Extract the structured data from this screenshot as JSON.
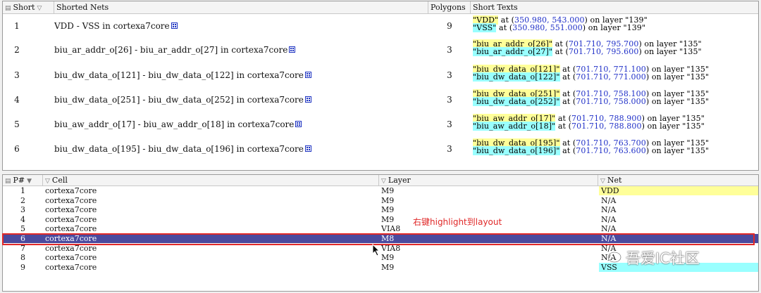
{
  "top_table": {
    "headers": {
      "short": "Short",
      "nets": "Shorted Nets",
      "polygons": "Polygons",
      "texts": "Short Texts"
    },
    "rows": [
      {
        "index": "1",
        "nets": "VDD - VSS in cortexa7core",
        "polygons": "9",
        "t1_name": "\"VDD\"",
        "t1_mid": " at (",
        "t1_coord": "350.980, 543.000",
        "t1_end": ") on layer \"139\"",
        "t2_name": "\"VSS\"",
        "t2_mid": " at (",
        "t2_coord": "350.980, 551.000",
        "t2_end": ") on layer \"139\""
      },
      {
        "index": "2",
        "nets": "biu_ar_addr_o[26] - biu_ar_addr_o[27] in cortexa7core",
        "polygons": "3",
        "t1_name": "\"biu_ar_addr_o[26]\"",
        "t1_mid": " at (",
        "t1_coord": "701.710, 795.700",
        "t1_end": ") on layer \"135\"",
        "t2_name": "\"biu_ar_addr_o[27]\"",
        "t2_mid": " at (",
        "t2_coord": "701.710, 795.600",
        "t2_end": ") on layer \"135\""
      },
      {
        "index": "3",
        "nets": "biu_dw_data_o[121] - biu_dw_data_o[122] in cortexa7core",
        "polygons": "3",
        "t1_name": "\"biu_dw_data_o[121]\"",
        "t1_mid": " at (",
        "t1_coord": "701.710, 771.100",
        "t1_end": ") on layer \"135\"",
        "t2_name": "\"biu_dw_data_o[122]\"",
        "t2_mid": " at (",
        "t2_coord": "701.710, 771.000",
        "t2_end": ") on layer \"135\""
      },
      {
        "index": "4",
        "nets": "biu_dw_data_o[251] - biu_dw_data_o[252] in cortexa7core",
        "polygons": "3",
        "t1_name": "\"biu_dw_data_o[251]\"",
        "t1_mid": " at (",
        "t1_coord": "701.710, 758.100",
        "t1_end": ") on layer \"135\"",
        "t2_name": "\"biu_dw_data_o[252]\"",
        "t2_mid": " at (",
        "t2_coord": "701.710, 758.000",
        "t2_end": ") on layer \"135\""
      },
      {
        "index": "5",
        "nets": "biu_aw_addr_o[17] - biu_aw_addr_o[18] in cortexa7core",
        "polygons": "3",
        "t1_name": "\"biu_aw_addr_o[17]\"",
        "t1_mid": " at (",
        "t1_coord": "701.710, 788.900",
        "t1_end": ") on layer \"135\"",
        "t2_name": "\"biu_aw_addr_o[18]\"",
        "t2_mid": " at (",
        "t2_coord": "701.710, 788.800",
        "t2_end": ") on layer \"135\""
      },
      {
        "index": "6",
        "nets": "biu_dw_data_o[195] - biu_dw_data_o[196] in cortexa7core",
        "polygons": "3",
        "t1_name": "\"biu_dw_data_o[195]\"",
        "t1_mid": " at (",
        "t1_coord": "701.710, 763.700",
        "t1_end": ") on layer \"135\"",
        "t2_name": "\"biu_dw_data_o[196]\"",
        "t2_mid": " at (",
        "t2_coord": "701.710, 763.600",
        "t2_end": ") on layer \"135\""
      }
    ]
  },
  "bottom_table": {
    "headers": {
      "p": "P#",
      "cell": "Cell",
      "layer": "Layer",
      "net": "Net"
    },
    "rows": [
      {
        "p": "1",
        "cell": "cortexa7core",
        "layer": "M9",
        "net": "VDD"
      },
      {
        "p": "2",
        "cell": "cortexa7core",
        "layer": "M9",
        "net": "N/A"
      },
      {
        "p": "3",
        "cell": "cortexa7core",
        "layer": "M9",
        "net": "N/A"
      },
      {
        "p": "4",
        "cell": "cortexa7core",
        "layer": "M9",
        "net": "N/A"
      },
      {
        "p": "5",
        "cell": "cortexa7core",
        "layer": "VIA8",
        "net": "N/A"
      },
      {
        "p": "6",
        "cell": "cortexa7core",
        "layer": "M8",
        "net": "N/A"
      },
      {
        "p": "7",
        "cell": "cortexa7core",
        "layer": "VIA8",
        "net": "N/A"
      },
      {
        "p": "8",
        "cell": "cortexa7core",
        "layer": "M9",
        "net": "N/A"
      },
      {
        "p": "9",
        "cell": "cortexa7core",
        "layer": "M9",
        "net": "VSS"
      }
    ],
    "selected_row": "6"
  },
  "annotation": "右键highlight到layout",
  "watermark": "吾爱IC社区",
  "colors": {
    "highlight_yellow": "#ffff99",
    "highlight_cyan": "#99ffff",
    "coord_blue": "#2030c8",
    "selection": "#4a4a9e",
    "annotation_red": "#e02828"
  }
}
